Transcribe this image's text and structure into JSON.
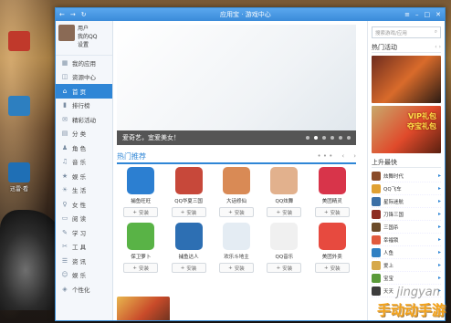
{
  "desktop": {
    "icons": [
      {
        "label": "",
        "color": "#c0392b"
      },
      {
        "label": "",
        "color": "#2d7fc0"
      },
      {
        "label": "迅雷·看",
        "color": "#1f6fb5"
      }
    ]
  },
  "window": {
    "title": "应用宝 · 游戏中心",
    "nav": {
      "back": "←",
      "forward": "→",
      "refresh": "↻"
    },
    "controls": {
      "menu": "≡",
      "minimize": "–",
      "maximize": "□",
      "close": "✕"
    }
  },
  "sidebar": {
    "user": {
      "line1": "用户",
      "line2": "我的QQ",
      "line3": "设置"
    },
    "items": [
      {
        "label": "我的应用",
        "icon": "apps-icon",
        "glyph": "▦"
      },
      {
        "label": "资源中心",
        "icon": "resource-icon",
        "glyph": "◫"
      },
      {
        "label": "首  页",
        "icon": "home-icon",
        "glyph": "⌂",
        "active": true
      },
      {
        "label": "排行榜",
        "icon": "ranking-icon",
        "glyph": "▮"
      },
      {
        "label": "精彩活动",
        "icon": "event-icon",
        "glyph": "✉"
      },
      {
        "label": "分  类",
        "icon": "category-icon",
        "glyph": "▤"
      },
      {
        "label": "角  色",
        "icon": "role-icon",
        "glyph": "♟"
      },
      {
        "label": "音  乐",
        "icon": "music-icon",
        "glyph": "♫"
      },
      {
        "label": "娱  乐",
        "icon": "entertainment-icon",
        "glyph": "★"
      },
      {
        "label": "生  活",
        "icon": "life-icon",
        "glyph": "☀"
      },
      {
        "label": "女  性",
        "icon": "female-icon",
        "glyph": "♀"
      },
      {
        "label": "阅  读",
        "icon": "reading-icon",
        "glyph": "▭"
      },
      {
        "label": "学  习",
        "icon": "study-icon",
        "glyph": "✎"
      },
      {
        "label": "工  具",
        "icon": "tools-icon",
        "glyph": "✂"
      },
      {
        "label": "资  讯",
        "icon": "news-icon",
        "glyph": "☰"
      },
      {
        "label": "娱  乐",
        "icon": "fun-icon",
        "glyph": "☺"
      },
      {
        "label": "个性化",
        "icon": "personalize-icon",
        "glyph": "◈"
      }
    ]
  },
  "banner": {
    "caption": "爱奇艺，宜爱美女！",
    "dots": 6,
    "active_dot": 1
  },
  "hot": {
    "title": "热门推荐",
    "controls": {
      "dots": "• • •",
      "prev": "‹",
      "next": "›"
    },
    "apps": [
      {
        "name": "捕鱼旺旺",
        "install": "安装",
        "color": "#2c7fd1"
      },
      {
        "name": "QQ华夏三国",
        "install": "安装",
        "color": "#c7483a"
      },
      {
        "name": "大话修仙",
        "install": "安装",
        "color": "#d98a55"
      },
      {
        "name": "QQ炫舞",
        "install": "安装",
        "color": "#e2b18d"
      },
      {
        "name": "美团精灵",
        "install": "安装",
        "color": "#d8344a"
      },
      {
        "name": "保卫萝卜",
        "install": "安装",
        "color": "#59b346"
      },
      {
        "name": "捕鱼达人",
        "install": "安装",
        "color": "#2d6fb3"
      },
      {
        "name": "欢乐斗地主",
        "install": "安装",
        "color": "#e4ecf3"
      },
      {
        "name": "QQ音乐",
        "install": "安装",
        "color": "#f0f0f0"
      },
      {
        "name": "美团外卖",
        "install": "安装",
        "color": "#e74a3f"
      }
    ]
  },
  "right": {
    "search_placeholder": "搜索游戏/应用",
    "search_icon": "search-icon",
    "activity_title": "热门活动",
    "activity_ctrl": "‹ ›",
    "ad2_text": "VIP礼包\n夺宝礼包",
    "rank_title": "上升最快",
    "rank": [
      {
        "name": "炫舞时代",
        "color": "#8a4c2a"
      },
      {
        "name": "QQ飞车",
        "color": "#e0a032"
      },
      {
        "name": "星际迷航",
        "color": "#3b6fa6"
      },
      {
        "name": "刀锋三国",
        "color": "#8c2d22"
      },
      {
        "name": "三国杀",
        "color": "#6b4a2a"
      },
      {
        "name": "幸福锁",
        "color": "#e0593d"
      },
      {
        "name": "人鱼",
        "color": "#2f7fc3"
      },
      {
        "name": "爱上",
        "color": "#d6a94b"
      },
      {
        "name": "宝宝",
        "color": "#5a9a3a"
      },
      {
        "name": "天天",
        "color": "#3c3c3c"
      }
    ]
  },
  "watermark": {
    "text": "手动动手游",
    "sub": "jingyan"
  }
}
